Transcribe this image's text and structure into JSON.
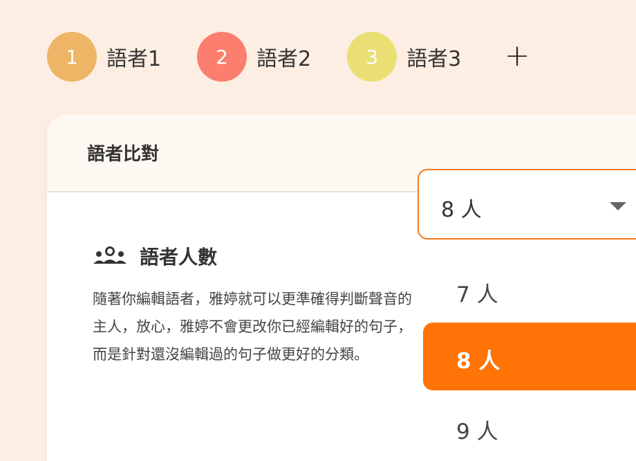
{
  "speakers": [
    {
      "number": "1",
      "label": "語者1",
      "color": "#efb567"
    },
    {
      "number": "2",
      "label": "語者2",
      "color": "#fb7e6e"
    },
    {
      "number": "3",
      "label": "語者3",
      "color": "#e9df73"
    }
  ],
  "add_icon": "plus-icon",
  "add_label": "+",
  "card": {
    "title": "語者比對",
    "section_icon": "people-icon",
    "section_title": "語者人數",
    "description": "隨著你編輯語者，雅婷就可以更準確得判斷聲音的主人，放心，雅婷不會更改你已經編輯好的句子，而是針對還沒編輯過的句子做更好的分類。"
  },
  "select": {
    "value": "8 人",
    "icon": "caret-down-icon",
    "border_color": "#ee7a1f",
    "options": [
      "7 人",
      "8 人",
      "9 人"
    ],
    "selected_index": 1,
    "highlight_color": "#ff7307"
  }
}
